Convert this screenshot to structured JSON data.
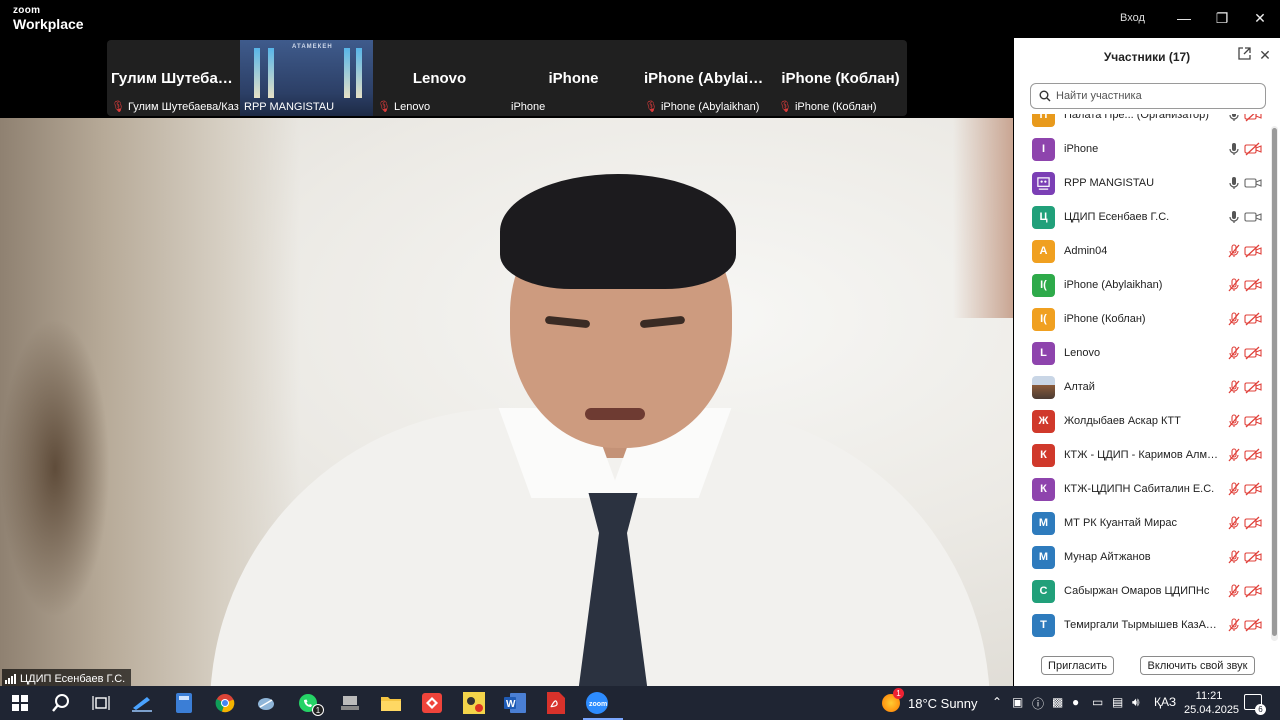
{
  "window": {
    "logo_top": "zoom",
    "logo_bottom": "Workplace",
    "login_label": "Вход"
  },
  "gallery": [
    {
      "big": "Гулим  Шутебае...",
      "caption": "Гулим Шутебаева/Каз...",
      "muted": true
    },
    {
      "big": "",
      "caption": "RPP MANGISTAU",
      "muted": false,
      "banner": "АТАМЕКЕН"
    },
    {
      "big": "Lenovo",
      "caption": "Lenovo",
      "muted": true
    },
    {
      "big": "iPhone",
      "caption": "iPhone",
      "muted": false
    },
    {
      "big": "iPhone  (Abylaik...",
      "caption": "iPhone (Abylaikhan)",
      "muted": true
    },
    {
      "big": "iPhone (Коблан)",
      "caption": "iPhone (Коблан)",
      "muted": true
    }
  ],
  "active_speaker": "ЦДИП Есенбаев Г.С.",
  "panel": {
    "title": "Участники (17)",
    "search_placeholder": "Найти участника",
    "invite_label": "Пригласить",
    "audio_label": "Включить свой звук"
  },
  "participants": [
    {
      "initial": "П",
      "color": "#e89a1c",
      "name": "Палата Пре...   (Организатор)",
      "mic": "on",
      "cam": "off"
    },
    {
      "initial": "I",
      "color": "#8e44ad",
      "name": "iPhone",
      "mic": "on",
      "cam": "off"
    },
    {
      "initial": "",
      "color": "#7b3fb5",
      "name": "RPP MANGISTAU",
      "mic": "on",
      "cam": "on",
      "room": true
    },
    {
      "initial": "Ц",
      "color": "#21a07a",
      "name": "ЦДИП Есенбаев Г.С.",
      "mic": "on",
      "cam": "on"
    },
    {
      "initial": "A",
      "color": "#f0a020",
      "name": "Admin04",
      "mic": "off",
      "cam": "off"
    },
    {
      "initial": "I(",
      "color": "#2eaa4a",
      "name": "iPhone (Abylaikhan)",
      "mic": "off",
      "cam": "off"
    },
    {
      "initial": "I(",
      "color": "#f0a020",
      "name": "iPhone (Коблан)",
      "mic": "off",
      "cam": "off"
    },
    {
      "initial": "L",
      "color": "#8e44ad",
      "name": "Lenovo",
      "mic": "off",
      "cam": "off"
    },
    {
      "initial": "",
      "color": "#6a6a6a",
      "name": "Алтай",
      "mic": "off",
      "cam": "off",
      "photo": true
    },
    {
      "initial": "Ж",
      "color": "#d0392b",
      "name": "Жолдыбаев Аскар КТТ",
      "mic": "off",
      "cam": "off"
    },
    {
      "initial": "К",
      "color": "#d0392b",
      "name": "КТЖ - ЦДИП - Каримов Алмас ...",
      "mic": "off",
      "cam": "off"
    },
    {
      "initial": "К",
      "color": "#8e44ad",
      "name": "КТЖ-ЦДИПН Сабиталин Е.С.",
      "mic": "off",
      "cam": "off"
    },
    {
      "initial": "М",
      "color": "#2e7bbd",
      "name": "МТ РК Куантай Мирас",
      "mic": "off",
      "cam": "off"
    },
    {
      "initial": "М",
      "color": "#2e7bbd",
      "name": "Мунар Айтжанов",
      "mic": "off",
      "cam": "off"
    },
    {
      "initial": "С",
      "color": "#21a07a",
      "name": "Сабыржан Омаров ЦДИПНс",
      "mic": "off",
      "cam": "off"
    },
    {
      "initial": "Т",
      "color": "#2e7bbd",
      "name": "Темиргали Тырмышев КазАПО",
      "mic": "off",
      "cam": "off"
    }
  ],
  "taskbar": {
    "whatsapp_badge": "1",
    "weather_badge": "1",
    "weather": "18°C  Sunny",
    "lang": "ҚАЗ",
    "time": "11:21",
    "date": "25.04.2025",
    "notif_count": "6"
  }
}
